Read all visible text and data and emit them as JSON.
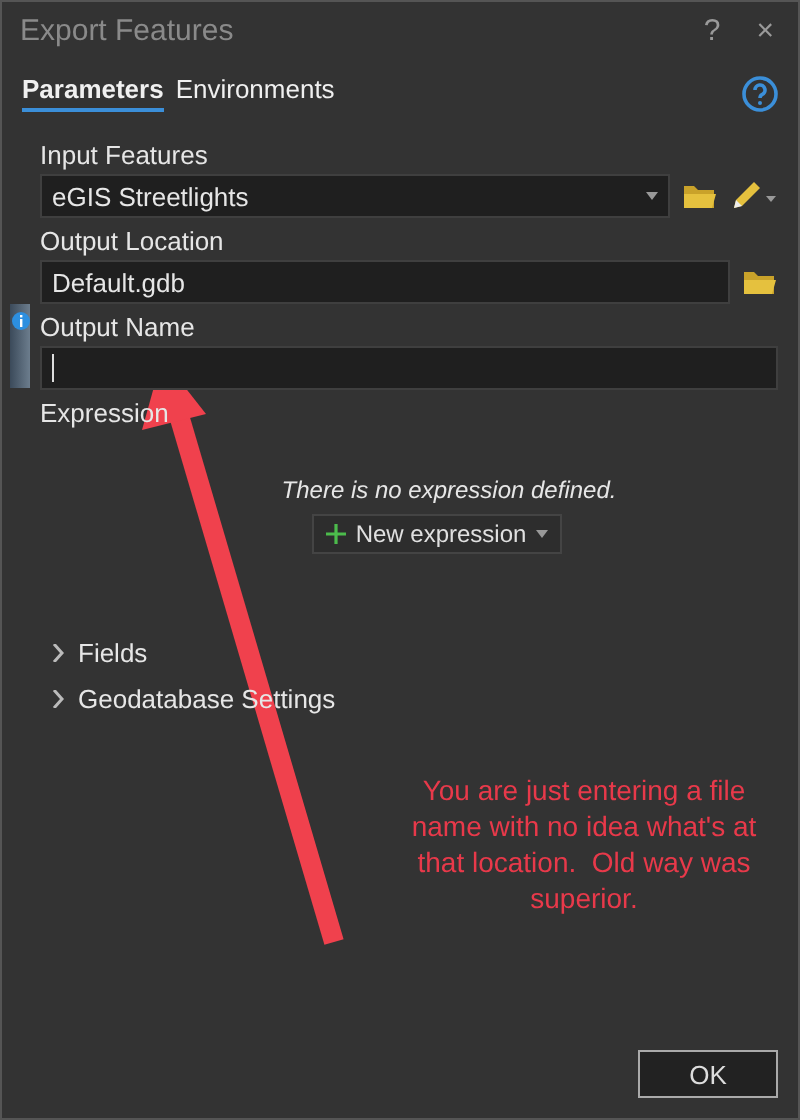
{
  "window": {
    "title": "Export Features"
  },
  "title_buttons": [
    "?",
    "×"
  ],
  "tabs": [
    {
      "label": "Parameters",
      "selected": true
    },
    {
      "label": "Environments",
      "selected": false
    }
  ],
  "parameters": [
    {
      "kind": "dropdown",
      "label": "Input Features",
      "value": "eGIS Streetlights",
      "info": false
    },
    {
      "kind": "text",
      "label": "Output Location",
      "value": "Default.gdb",
      "info": false
    },
    {
      "kind": "text",
      "label": "Output Name",
      "info": true
    }
  ],
  "expression": {
    "label": "Expression",
    "empty_message": "There is no expression defined.",
    "button": "New expression"
  },
  "sections": [
    {
      "label": "Fields",
      "expanded": false
    },
    {
      "label": "Geodatabase Settings",
      "expanded": false
    }
  ],
  "annotation": {
    "text": "You are just entering a file name with no idea what's at that location.  Old way was superior."
  },
  "buttons": [
    "OK"
  ]
}
